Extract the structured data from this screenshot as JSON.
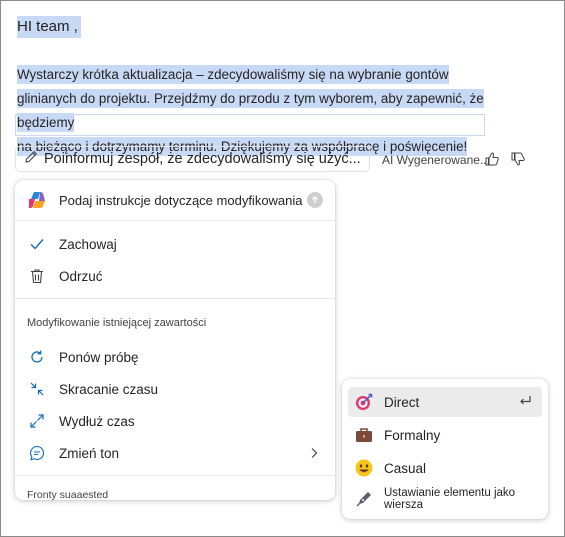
{
  "document": {
    "greeting": "HI team ,",
    "paragraph_lines": [
      "Wystarczy krótka aktualizacja – zdecydowaliśmy się na wybranie gontów",
      "glinianych do projektu. Przejdźmy do przodu z tym wyborem, aby zapewnić, że będziemy",
      "na bieżąco i dotrzymamy terminu. Dziękujemy za współpracę i poświęcenie!"
    ]
  },
  "prompt_bar": {
    "prompt_text": "Poinformuj zespół, że zdecydowaliśmy się użyć...",
    "ai_label": "AI Wygenerowane..."
  },
  "menu": {
    "instruction_placeholder": "Podaj instrukcje dotyczące modyfikowania",
    "keep_label": "Zachowaj",
    "discard_label": "Odrzuć",
    "section_label": "Modyfikowanie istniejącej zawartości",
    "retry_label": "Ponów próbę",
    "shorten_label": "Skracanie czasu",
    "lengthen_label": "Wydłuż czas",
    "change_tone_label": "Zmień ton",
    "suggested_label": "Fronty suaaested"
  },
  "tone_submenu": {
    "items": [
      {
        "label": "Direct",
        "icon": "target-icon"
      },
      {
        "label": "Formalny",
        "icon": "briefcase-icon"
      },
      {
        "label": "Casual",
        "icon": "smiley-icon"
      },
      {
        "label": "Ustawianie elementu jako wiersza",
        "icon": "pen-nib-icon"
      }
    ]
  },
  "colors": {
    "selection": "#c7d9f4",
    "accent_blue": "#0f6cbd",
    "target_pink": "#e3356e",
    "briefcase_brown": "#7a4a3a",
    "smiley_yellow": "#f5c518"
  }
}
